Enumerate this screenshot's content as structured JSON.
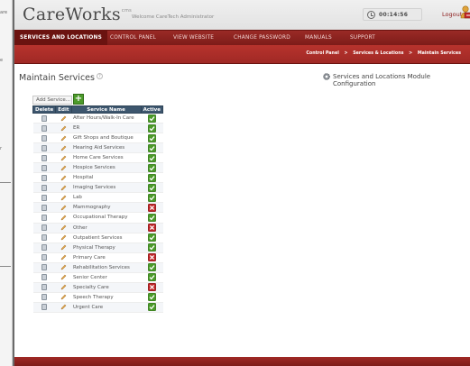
{
  "left_strip": {
    "fragments": [
      "are",
      "e",
      "r"
    ]
  },
  "header": {
    "logo": "CareWorks",
    "logo_mark": "cms",
    "welcome": "Welcome CareTech Administrator",
    "clock": "00:14:56",
    "logout": "Logout"
  },
  "nav": {
    "items": [
      "SERVICES AND LOCATIONS",
      "CONTROL PANEL",
      "VIEW WEBSITE",
      "CHANGE PASSWORD",
      "MANUALS",
      "SUPPORT"
    ]
  },
  "breadcrumb": {
    "items": [
      "Control Panel",
      "Services & Locations",
      "Maintain Services"
    ],
    "separator": ">"
  },
  "page": {
    "title": "Maintain Services",
    "help": "?",
    "config_link": "Services and Locations Module Configuration",
    "add_button": "Add Service..."
  },
  "table": {
    "headers": [
      "Delete",
      "Edit",
      "Service Name",
      "Active"
    ],
    "rows": [
      {
        "name": "After Hours/Walk-In Care",
        "active": true
      },
      {
        "name": "ER",
        "active": true
      },
      {
        "name": "Gift Shops and Boutique",
        "active": true
      },
      {
        "name": "Hearing Aid Services",
        "active": true
      },
      {
        "name": "Home Care Services",
        "active": true
      },
      {
        "name": "Hospice Services",
        "active": true
      },
      {
        "name": "Hospital",
        "active": true
      },
      {
        "name": "Imaging Services",
        "active": true
      },
      {
        "name": "Lab",
        "active": true
      },
      {
        "name": "Mammography",
        "active": false
      },
      {
        "name": "Occupational Therapy",
        "active": true
      },
      {
        "name": "Other",
        "active": false
      },
      {
        "name": "Outpatient Services",
        "active": true
      },
      {
        "name": "Physical Therapy",
        "active": true
      },
      {
        "name": "Primary Care",
        "active": false
      },
      {
        "name": "Rehabilitation Services",
        "active": true
      },
      {
        "name": "Senior Center",
        "active": true
      },
      {
        "name": "Specialty Care",
        "active": false
      },
      {
        "name": "Speech Therapy",
        "active": true
      },
      {
        "name": "Urgent Care",
        "active": true
      }
    ]
  },
  "colors": {
    "nav": "#8b2220",
    "header_table": "#3d566e",
    "active_check": "#4c9a2a",
    "inactive_x": "#c0282a"
  }
}
